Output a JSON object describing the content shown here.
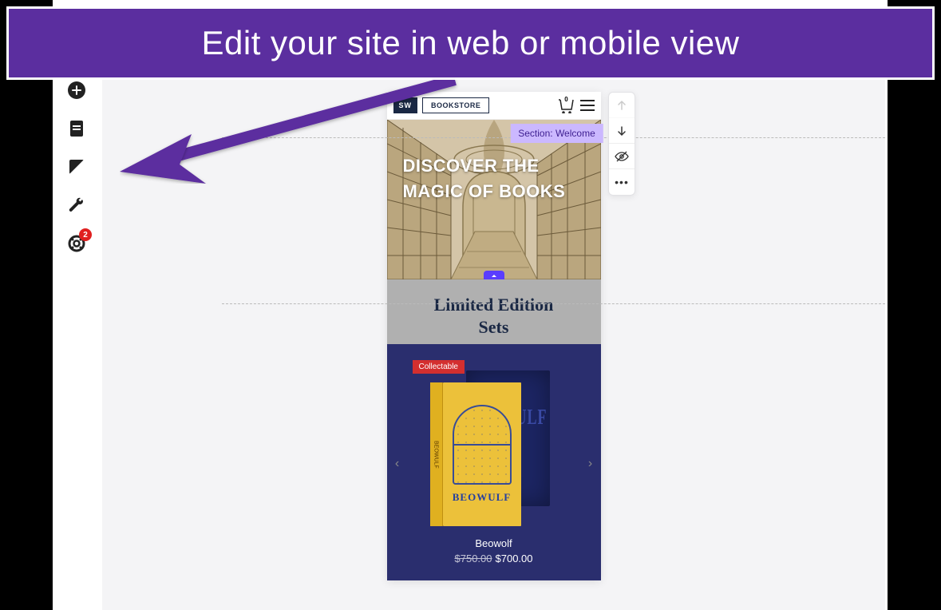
{
  "annotation": {
    "title": "Edit your site in web or mobile view"
  },
  "sidebar": {
    "add": "add",
    "pages": "pages",
    "edit": "edit",
    "settings": "settings",
    "help": "help",
    "badge_count": "2"
  },
  "section_tag": "Section: Welcome",
  "preview": {
    "logo": "SW",
    "brand": "BOOKSTORE",
    "cart_count": "0",
    "hero_text": "DISCOVER THE MAGIC OF BOOKS",
    "limited_title_line1": "Limited Edition",
    "limited_title_line2": "Sets",
    "product": {
      "badge": "Collectable",
      "front_title": "BEOWULF",
      "back_title": "BEOWULF",
      "spine": "BEOWULF",
      "name": "Beowolf",
      "old_price": "$750.00",
      "price": "$700.00"
    }
  },
  "float_toolbar": {
    "up": "↑",
    "down": "↓",
    "hide": "hide",
    "more": "…"
  }
}
